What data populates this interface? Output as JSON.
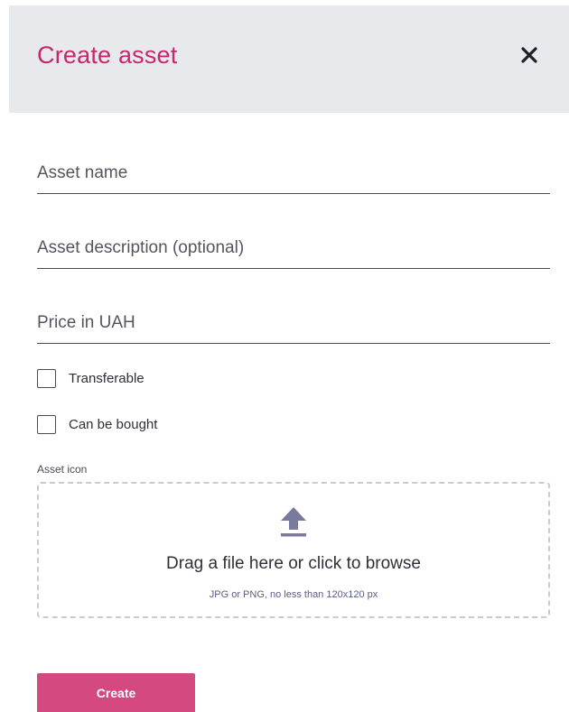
{
  "dialog": {
    "title": "Create asset",
    "close_icon": "close-icon"
  },
  "form": {
    "asset_name": {
      "placeholder": "Asset name",
      "value": ""
    },
    "asset_description": {
      "placeholder": "Asset description (optional)",
      "value": ""
    },
    "price": {
      "placeholder": "Price in UAH",
      "value": ""
    },
    "transferable": {
      "label": "Transferable",
      "checked": false
    },
    "can_be_bought": {
      "label": "Can be bought",
      "checked": false
    },
    "asset_icon": {
      "label": "Asset icon",
      "dropzone_title": "Drag a file here or click to browse",
      "dropzone_hint": "JPG or PNG, no less than 120x120 px",
      "icon": "upload-icon"
    },
    "submit_label": "Create"
  },
  "colors": {
    "accent": "#c8266d",
    "button": "#d4497f",
    "header_bg": "#e8e9ed",
    "upload_icon": "#7a7a9e"
  }
}
